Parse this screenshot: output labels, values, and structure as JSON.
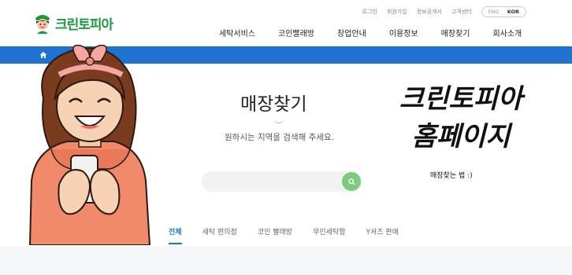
{
  "brand": {
    "name": "크린토피아"
  },
  "utility": {
    "items": [
      "로그인",
      "회원가입",
      "정보공개서",
      "고객센터"
    ],
    "lang": [
      "ENG",
      "KOR"
    ]
  },
  "gnb": {
    "items": [
      "세탁서비스",
      "코인빨래방",
      "창업안내",
      "이용정보",
      "매장찾기",
      "회사소개"
    ]
  },
  "page": {
    "title": "매장찾기",
    "subtitle": "원하시는 지역을 검색해 주세요."
  },
  "search": {
    "value": "",
    "placeholder": ""
  },
  "tabs": {
    "items": [
      "전체",
      "세탁 편의점",
      "코인 빨래방",
      "무인세탁함",
      "Y셔츠 판매"
    ],
    "active": 0
  },
  "overlay": {
    "title_line1": "크린토피아",
    "title_line2": "홈페이지",
    "sub": "매장찾는 법 :)"
  },
  "colors": {
    "brand_green": "#1e9a3a",
    "nav_blue": "#1e73d0",
    "search_green": "#7ecb7e"
  },
  "icons": [
    "home-icon",
    "search-icon",
    "logo-icon"
  ]
}
